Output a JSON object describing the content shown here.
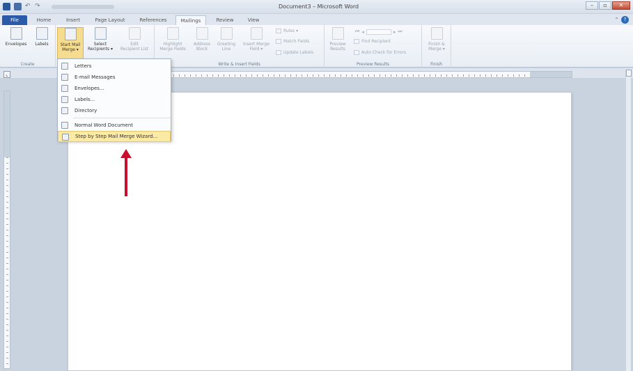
{
  "window": {
    "title": "Document3 – Microsoft Word"
  },
  "tabs": [
    {
      "label": "File"
    },
    {
      "label": "Home"
    },
    {
      "label": "Insert"
    },
    {
      "label": "Page Layout"
    },
    {
      "label": "References"
    },
    {
      "label": "Mailings"
    },
    {
      "label": "Review"
    },
    {
      "label": "View"
    }
  ],
  "ribbon": {
    "create": {
      "label": "Create",
      "envelopes": "Envelopes",
      "labels": "Labels"
    },
    "start": {
      "start_line1": "Start Mail",
      "start_line2": "Merge ▾",
      "select_line1": "Select",
      "select_line2": "Recipients ▾",
      "edit_line1": "Edit",
      "edit_line2": "Recipient List"
    },
    "write": {
      "label": "Write & Insert Fields",
      "highlight_line1": "Highlight",
      "highlight_line2": "Merge Fields",
      "address_line1": "Address",
      "address_line2": "Block",
      "greeting_line1": "Greeting",
      "greeting_line2": "Line",
      "insert_line1": "Insert Merge",
      "insert_line2": "Field ▾",
      "rules": "Rules ▾",
      "match": "Match Fields",
      "update": "Update Labels"
    },
    "preview": {
      "label": "Preview Results",
      "preview_line1": "Preview",
      "preview_line2": "Results",
      "find": "Find Recipient",
      "auto": "Auto Check for Errors"
    },
    "finish": {
      "label": "Finish",
      "finish_line1": "Finish &",
      "finish_line2": "Merge ▾"
    }
  },
  "menu": {
    "items": [
      {
        "label": "Letters"
      },
      {
        "label": "E-mail Messages"
      },
      {
        "label": "Envelopes..."
      },
      {
        "label": "Labels..."
      },
      {
        "label": "Directory"
      },
      {
        "label": "Normal Word Document"
      },
      {
        "label": "Step by Step Mail Merge Wizard..."
      }
    ]
  },
  "colors": {
    "file_tab": "#2a5aa8",
    "highlight": "#fbeaa5",
    "arrow": "#c8102e"
  }
}
